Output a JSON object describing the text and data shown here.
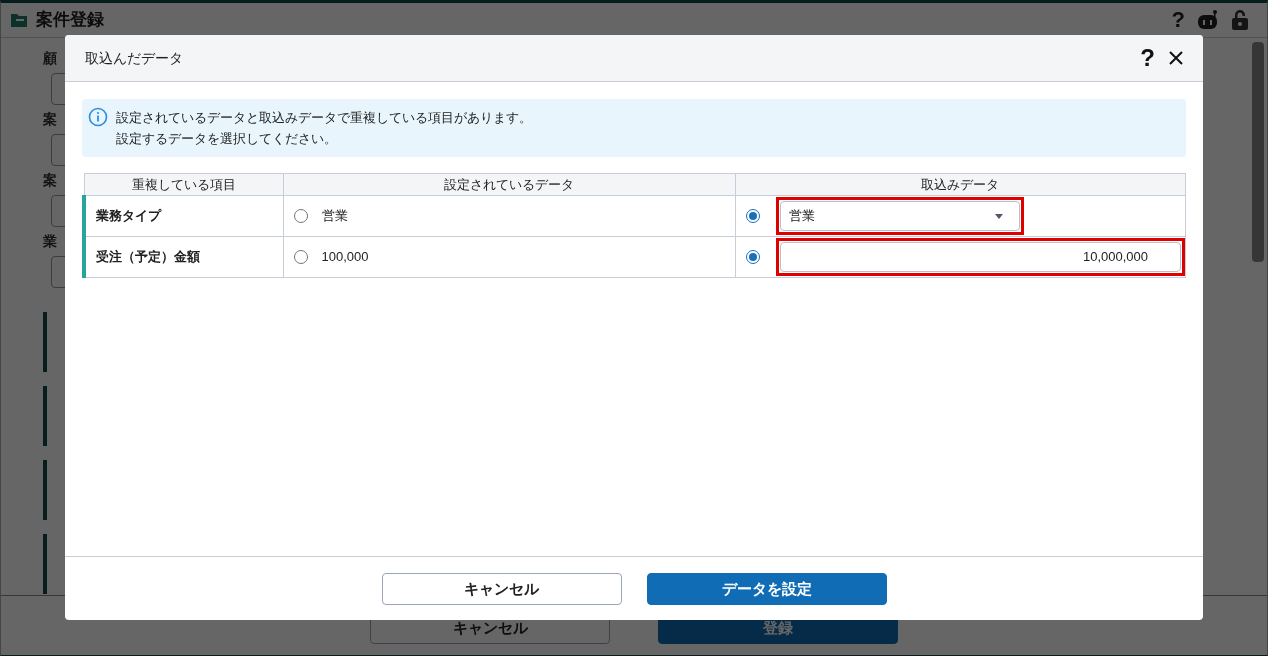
{
  "page": {
    "title": "案件登録",
    "help": "?",
    "fields": [
      {
        "label": "顧"
      },
      {
        "label": "案"
      },
      {
        "label": "案"
      },
      {
        "label": "業"
      }
    ],
    "footer_buttons": [
      {
        "label": "キャンセル",
        "kind": "secondary"
      },
      {
        "label": "登録",
        "kind": "primary"
      }
    ]
  },
  "dialog": {
    "title": "取込んだデータ",
    "help": "?",
    "message": [
      "設定されているデータと取込みデータで重複している項目があります。",
      "設定するデータを選択してください。"
    ],
    "table": {
      "columns": [
        "重複している項目",
        "設定されているデータ",
        "取込みデータ"
      ],
      "rows": [
        {
          "item": "業務タイプ",
          "current": {
            "value": "営業",
            "selected": false
          },
          "imported": {
            "kind": "select",
            "value": "営業",
            "selected": true,
            "highlighted": true
          }
        },
        {
          "item": "受注（予定）金額",
          "current": {
            "value": "100,000",
            "selected": false
          },
          "imported": {
            "kind": "number",
            "value": "10,000,000",
            "selected": true,
            "highlighted": true
          }
        }
      ]
    },
    "buttons": [
      {
        "label": "キャンセル",
        "kind": "secondary"
      },
      {
        "label": "データを設定",
        "kind": "primary"
      }
    ]
  }
}
